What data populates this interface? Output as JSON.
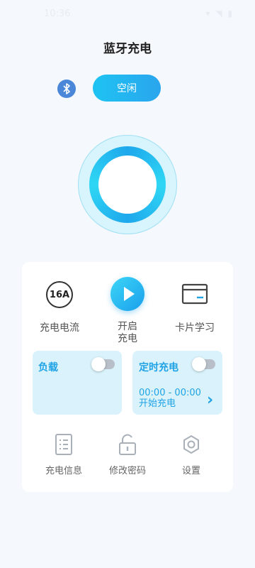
{
  "header": {
    "title": "蓝牙充电",
    "status": "空闲",
    "bluetooth_icon": "bluetooth-icon"
  },
  "functions": [
    {
      "label": "充电电流",
      "icon": "current-16a-icon",
      "icon_text": "16A"
    },
    {
      "label_line1": "开启",
      "label_line2": "充电",
      "icon": "play-icon"
    },
    {
      "label": "卡片学习",
      "icon": "card-icon"
    }
  ],
  "load_panel": {
    "title": "负载",
    "toggle": false
  },
  "timer_panel": {
    "title": "定时充电",
    "toggle": false,
    "time_range": "00:00 - 00:00",
    "action": "开始充电"
  },
  "bottom_menu": [
    {
      "label": "充电信息",
      "icon": "document-list-icon"
    },
    {
      "label": "修改密码",
      "icon": "unlock-icon"
    },
    {
      "label": "设置",
      "icon": "gear-icon"
    }
  ],
  "colors": {
    "accent": "#1fa3e6",
    "panel_bg": "#d9f2fb",
    "page_bg": "#f5f8fd",
    "bluetooth": "#4a87d8"
  }
}
